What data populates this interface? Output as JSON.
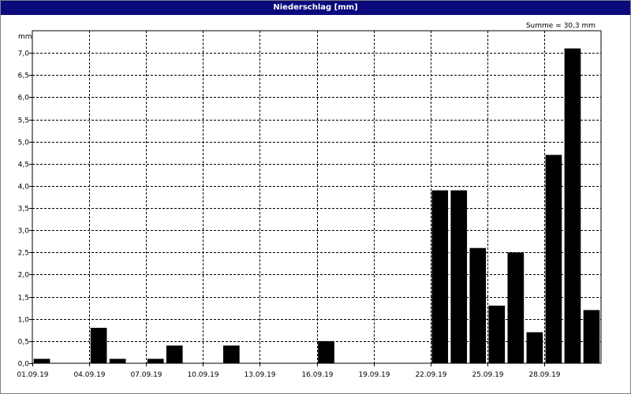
{
  "window": {
    "title": "Niederschlag [mm]"
  },
  "chart_data": {
    "type": "bar",
    "title": "Niederschlag [mm]",
    "annotation": "Summe = 30,3 mm",
    "ylabel": "mm",
    "ylim": [
      0,
      7.5
    ],
    "y_ticks": [
      "0,0",
      "0,5",
      "1,0",
      "1,5",
      "2,0",
      "2,5",
      "3,0",
      "3,5",
      "4,0",
      "4,5",
      "5,0",
      "5,5",
      "6,0",
      "6,5",
      "7,0"
    ],
    "x_ticks": [
      "01.09.19",
      "04.09.19",
      "07.09.19",
      "10.09.19",
      "13.09.19",
      "16.09.19",
      "19.09.19",
      "22.09.19",
      "25.09.19",
      "28.09.19"
    ],
    "categories": [
      "01.09.19",
      "02.09.19",
      "03.09.19",
      "04.09.19",
      "05.09.19",
      "06.09.19",
      "07.09.19",
      "08.09.19",
      "09.09.19",
      "10.09.19",
      "11.09.19",
      "12.09.19",
      "13.09.19",
      "14.09.19",
      "15.09.19",
      "16.09.19",
      "17.09.19",
      "18.09.19",
      "19.09.19",
      "20.09.19",
      "21.09.19",
      "22.09.19",
      "23.09.19",
      "24.09.19",
      "25.09.19",
      "26.09.19",
      "27.09.19",
      "28.09.19",
      "29.09.19",
      "30.09.19"
    ],
    "values": [
      0.1,
      0,
      0,
      0.8,
      0.1,
      0,
      0.1,
      0.4,
      0,
      0,
      0.4,
      0,
      0,
      0,
      0,
      0.5,
      0,
      0,
      0,
      0,
      0,
      3.9,
      3.9,
      2.6,
      1.3,
      2.5,
      0.7,
      4.7,
      7.1,
      1.2
    ],
    "bar_color": "#000000",
    "grid": true
  }
}
